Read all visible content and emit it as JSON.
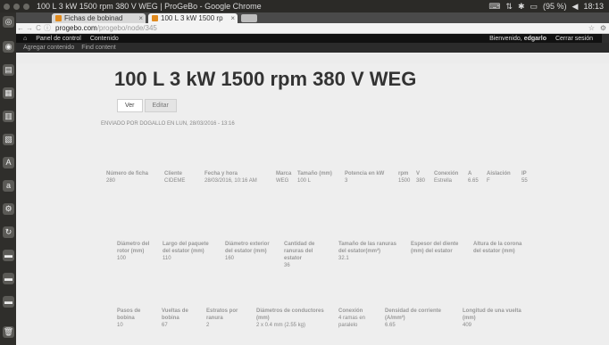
{
  "system": {
    "window_title": "100 L 3 kW 1500 rpm 380 V WEG | ProGeBo - Google Chrome",
    "tray": {
      "battery": "(95 %)",
      "time": "18:13"
    }
  },
  "browser": {
    "tabs": [
      {
        "label": "Fichas de bobinad",
        "close": "×"
      },
      {
        "label": "100 L 3 kW 1500 rp",
        "close": "×"
      }
    ],
    "url_host": "progebo.com",
    "url_path": "/progebo/node/345"
  },
  "toolbar": {
    "home": "Panel de control",
    "content": "Contenido",
    "welcome_prefix": "Bienvenido,",
    "username": "edgarlo",
    "logout": "Cerrar sesión"
  },
  "shortcuts": [
    "Agregar contenido",
    "Find content"
  ],
  "page": {
    "title": "100 L 3 kW 1500 rpm 380 V WEG",
    "tabs": [
      "Ver",
      "Editar"
    ],
    "submitted": "ENVIADO POR DOGALLO EN LUN, 28/03/2016 - 13:16",
    "row1": [
      {
        "label": "Número de ficha",
        "value": "280"
      },
      {
        "label": "Cliente",
        "value": "CIDEME"
      },
      {
        "label": "Fecha y hora",
        "value": "28/03/2016, 10:16 AM"
      },
      {
        "label": "Marca",
        "value": "WEG"
      },
      {
        "label": "Tamaño (mm)",
        "value": "100 L"
      },
      {
        "label": "Potencia en kW",
        "value": "3"
      },
      {
        "label": "rpm",
        "value": "1500"
      },
      {
        "label": "V",
        "value": "380"
      },
      {
        "label": "Conexión",
        "value": "Estrella"
      },
      {
        "label": "A",
        "value": "6.65"
      },
      {
        "label": "Aislación",
        "value": "F"
      },
      {
        "label": "IP",
        "value": "55"
      }
    ],
    "row2": [
      {
        "label": "Diámetro del\nrotor (mm)",
        "value": "100"
      },
      {
        "label": "Largo del paquete\ndel estator (mm)",
        "value": "110"
      },
      {
        "label": "Diámetro exterior\ndel estator (mm)",
        "value": "160"
      },
      {
        "label": "Cantidad de\nranuras del\nestator",
        "value": "36"
      },
      {
        "label": "Tamaño de las ranuras\ndel estator(mm²)",
        "value": "32.1"
      },
      {
        "label": "Espesor del diente\n(mm) del estator",
        "value": ""
      },
      {
        "label": "Altura de la corona\ndel estator (mm)",
        "value": ""
      }
    ],
    "row3": [
      {
        "label": "Pasos de\nbobina",
        "value": "10"
      },
      {
        "label": "Vueltas de\nbobina",
        "value": "67"
      },
      {
        "label": "Estratos por\nranura",
        "value": "2"
      },
      {
        "label": "Diámetros de conductores\n(mm)",
        "value": "2 x 0.4 mm (2.55 kg)"
      },
      {
        "label": "Conexión",
        "value": "4 ramas en\nparalelo"
      },
      {
        "label": "Densidad de corriente\n(A/mm²)",
        "value": "6.65"
      },
      {
        "label": "Longitud de una vuelta\n(mm)",
        "value": "409"
      }
    ]
  },
  "launcher": [
    "dash",
    "files",
    "writer",
    "calc",
    "impress",
    "software-center",
    "amazon",
    "settings",
    "update",
    "drive-1",
    "drive-2",
    "drive-3",
    "trash"
  ]
}
